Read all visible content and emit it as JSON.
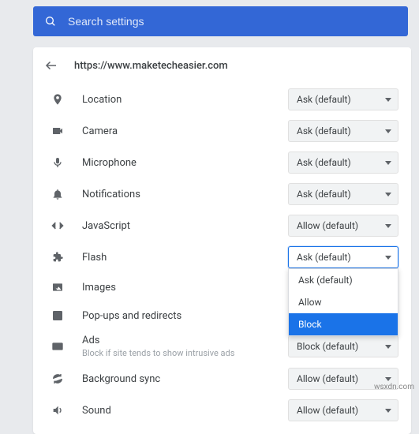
{
  "search": {
    "placeholder": "Search settings"
  },
  "site_url": "https://www.maketecheasier.com",
  "permissions": [
    {
      "key": "location",
      "label": "Location",
      "value": "Ask (default)",
      "icon": "location-icon"
    },
    {
      "key": "camera",
      "label": "Camera",
      "value": "Ask (default)",
      "icon": "camera-icon"
    },
    {
      "key": "microphone",
      "label": "Microphone",
      "value": "Ask (default)",
      "icon": "microphone-icon"
    },
    {
      "key": "notifications",
      "label": "Notifications",
      "value": "Ask (default)",
      "icon": "bell-icon"
    },
    {
      "key": "javascript",
      "label": "JavaScript",
      "value": "Allow (default)",
      "icon": "code-icon"
    },
    {
      "key": "flash",
      "label": "Flash",
      "value": "Ask (default)",
      "icon": "puzzle-icon",
      "open": true
    },
    {
      "key": "images",
      "label": "Images",
      "value": "",
      "icon": "images-icon",
      "noSelect": true
    },
    {
      "key": "popups",
      "label": "Pop-ups and redirects",
      "value": "",
      "icon": "popup-icon",
      "noSelect": true
    },
    {
      "key": "ads",
      "label": "Ads",
      "sub": "Block if site tends to show intrusive ads",
      "value": "Block (default)",
      "icon": "ads-icon"
    },
    {
      "key": "bgsync",
      "label": "Background sync",
      "value": "Allow (default)",
      "icon": "sync-icon"
    },
    {
      "key": "sound",
      "label": "Sound",
      "value": "Allow (default)",
      "icon": "sound-icon"
    }
  ],
  "flash_options": [
    {
      "label": "Ask (default)",
      "highlight": false
    },
    {
      "label": "Allow",
      "highlight": false
    },
    {
      "label": "Block",
      "highlight": true
    }
  ],
  "watermark": "wsxdn.com"
}
